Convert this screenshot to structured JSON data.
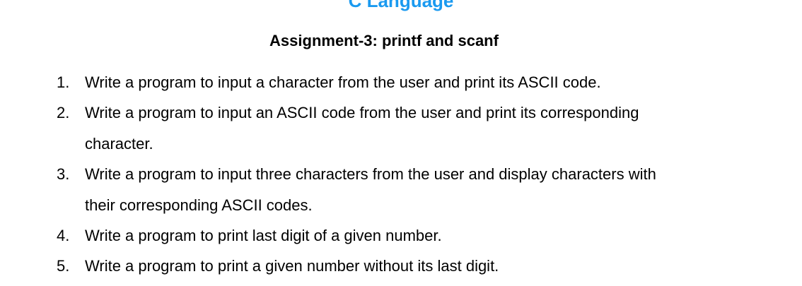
{
  "document": {
    "heading": "C Language",
    "heading_color": "#1a9af0",
    "subtitle": "Assignment-3: printf and scanf",
    "questions": [
      {
        "number": "1.",
        "lines": [
          "Write a program to input a character from the user and print its ASCII code."
        ]
      },
      {
        "number": "2.",
        "lines": [
          "Write a program to input an ASCII code from the user and print its corresponding",
          "character."
        ]
      },
      {
        "number": "3.",
        "lines": [
          "Write a program to input three characters from the user and display characters with",
          "their corresponding ASCII codes."
        ]
      },
      {
        "number": "4.",
        "lines": [
          "Write a program to print last digit of a given number."
        ]
      },
      {
        "number": "5.",
        "lines": [
          "Write a program to print a given number without its last digit."
        ]
      }
    ]
  }
}
